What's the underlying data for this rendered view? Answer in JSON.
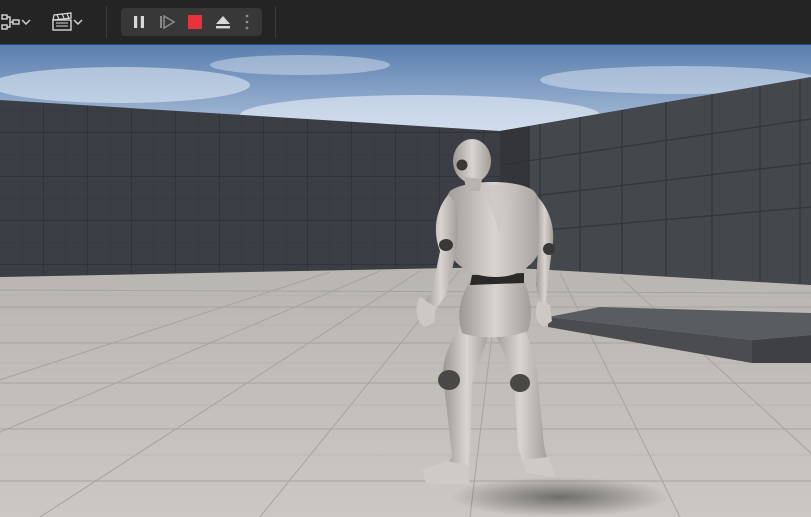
{
  "toolbar": {
    "icons": [
      "blueprint-icon",
      "chevron-down-icon",
      "cinematics-icon",
      "chevron-down-icon"
    ],
    "play_controls": [
      {
        "name": "pause-button",
        "icon": "pause-icon"
      },
      {
        "name": "frame-skip-button",
        "icon": "frame-skip-icon"
      },
      {
        "name": "stop-button",
        "icon": "stop-icon",
        "color": "#e8313a"
      },
      {
        "name": "eject-button",
        "icon": "eject-icon"
      },
      {
        "name": "more-options-button",
        "icon": "kebab-icon"
      }
    ]
  },
  "viewport": {
    "scene": "third-person-level",
    "character": "mannequin",
    "colors": {
      "sky_top": "#5b7fae",
      "sky_bottom": "#c9d8ea",
      "wall": "#3b3e44",
      "floor": "#c4c0bc",
      "ramp": "#55585a"
    }
  }
}
